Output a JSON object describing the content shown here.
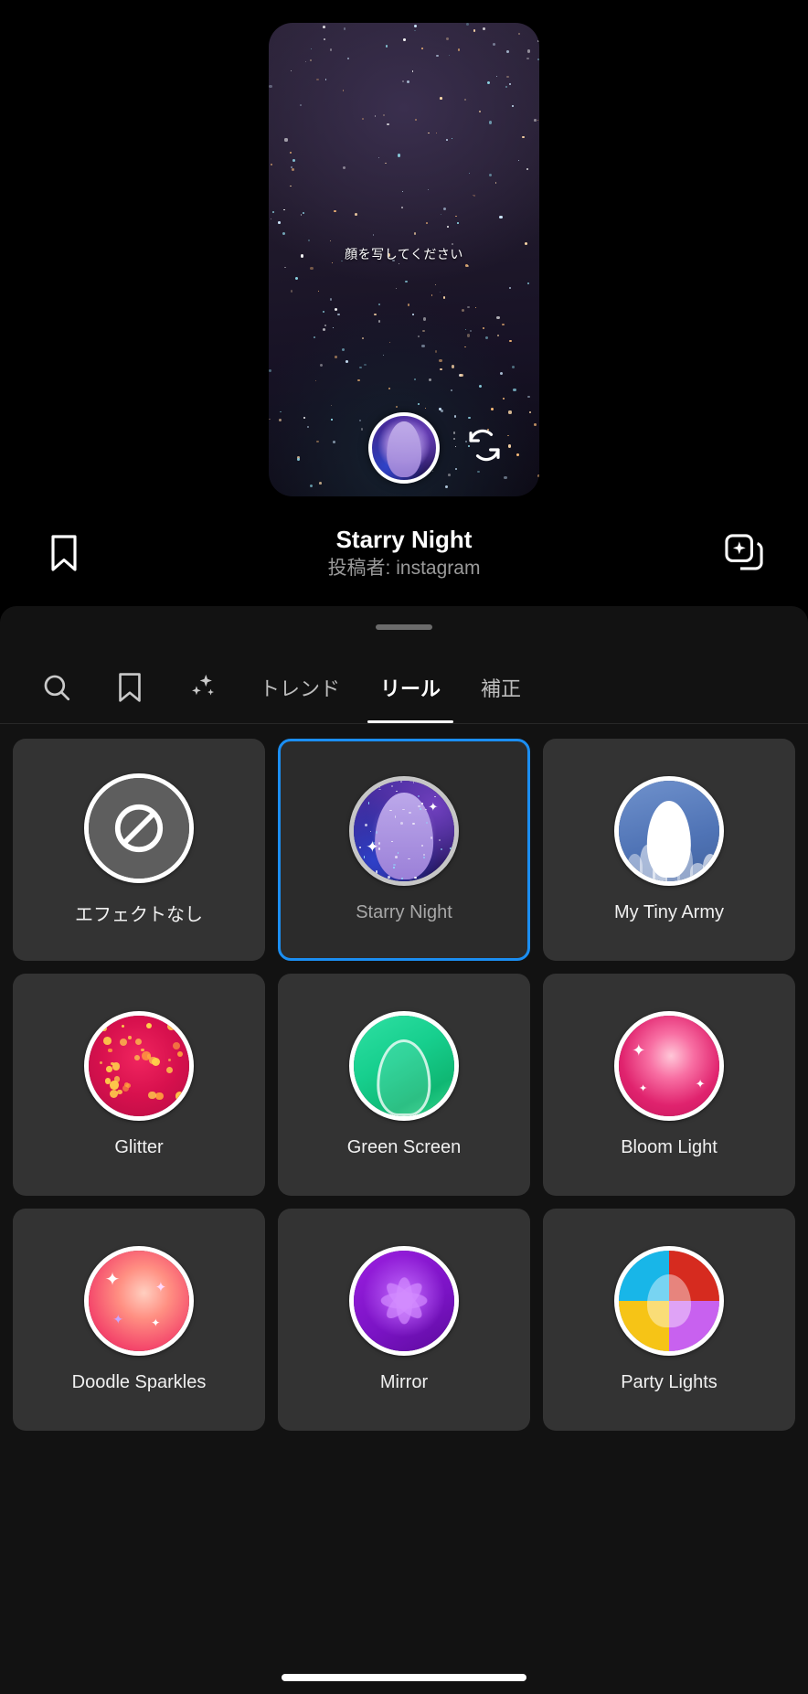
{
  "preview": {
    "hint_text": "顔を写してください",
    "shutter_name": "shutter-button",
    "flip_camera_icon": "flip-camera-icon"
  },
  "title_bar": {
    "save_icon": "bookmark-icon",
    "effect_title": "Starry Night",
    "effect_author": "投稿者: instagram",
    "add_to_collection_icon": "add-effect-icon"
  },
  "tabs": {
    "icons": [
      {
        "name": "search-icon",
        "glyph": "search"
      },
      {
        "name": "saved-icon",
        "glyph": "bookmark"
      },
      {
        "name": "sparkles-icon",
        "glyph": "sparkles"
      }
    ],
    "items": [
      {
        "label": "トレンド",
        "active": false
      },
      {
        "label": "リール",
        "active": true
      },
      {
        "label": "補正",
        "active": false
      }
    ]
  },
  "effects": [
    {
      "label": "エフェクトなし",
      "selected": false,
      "art": "none"
    },
    {
      "label": "Starry Night",
      "selected": true,
      "art": "starry"
    },
    {
      "label": "My Tiny Army",
      "selected": false,
      "art": "army"
    },
    {
      "label": "Glitter",
      "selected": false,
      "art": "glitter"
    },
    {
      "label": "Green Screen",
      "selected": false,
      "art": "green"
    },
    {
      "label": "Bloom Light",
      "selected": false,
      "art": "bloom"
    },
    {
      "label": "Doodle Sparkles",
      "selected": false,
      "art": "doodle"
    },
    {
      "label": "Mirror",
      "selected": false,
      "art": "mirror"
    },
    {
      "label": "Party Lights",
      "selected": false,
      "art": "party"
    }
  ],
  "colors": {
    "accent_selected": "#1b8ef2",
    "sheet_background": "#121212",
    "card_background": "#333333",
    "label_text": "#f0f0f0",
    "author_text": "#9a9a9a"
  }
}
